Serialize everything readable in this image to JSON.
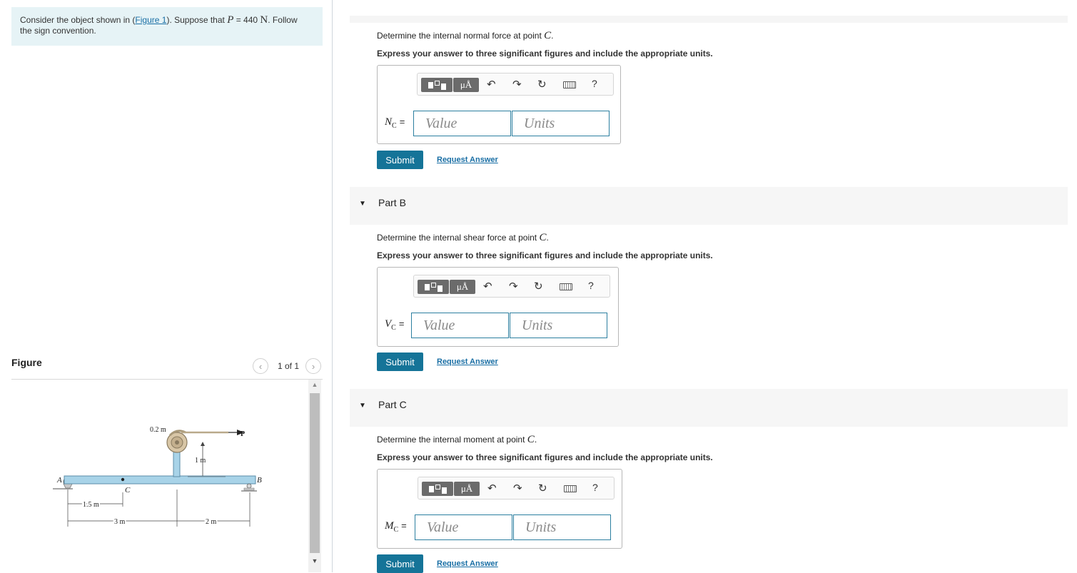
{
  "problem": {
    "text_before_link": "Consider the object shown in (",
    "figure_link": "Figure 1",
    "text_after_link": "). Suppose that",
    "var_P": "P",
    "equals": "= 440",
    "unit_N": "N",
    "text_end_1": ". Follow",
    "text_end_2": "the sign convention."
  },
  "figure_panel": {
    "title": "Figure",
    "counter": "1 of 1",
    "prev_icon": "chevron-left-icon",
    "next_icon": "chevron-right-icon",
    "labels": {
      "dim_02m": "0.2 m",
      "P": "P",
      "dim_1m": "1 m",
      "A": "A",
      "B": "B",
      "C": "C",
      "dim_15m": "1.5 m",
      "dim_3m": "3 m",
      "dim_2m": "2 m"
    }
  },
  "toolbar": {
    "templates_icon": "templates-icon",
    "units_label": "μÅ",
    "undo_icon": "undo-icon",
    "redo_icon": "redo-icon",
    "reset_icon": "reset-icon",
    "keyboard_icon": "keyboard-icon",
    "help_label": "?"
  },
  "parts": [
    {
      "id": "A",
      "question_before": "Determine the internal normal force at point",
      "question_point": "C",
      "instruction": "Express your answer to three significant figures and include the appropriate units.",
      "lhs_var": "N",
      "lhs_sub": "C",
      "lhs_eq": "=",
      "value_placeholder": "Value",
      "units_placeholder": "Units",
      "submit_label": "Submit",
      "request_label": "Request Answer"
    },
    {
      "id": "B",
      "header": "Part B",
      "question_before": "Determine the internal shear force at point",
      "question_point": "C",
      "instruction": "Express your answer to three significant figures and include the appropriate units.",
      "lhs_var": "V",
      "lhs_sub": "C",
      "lhs_eq": "=",
      "value_placeholder": "Value",
      "units_placeholder": "Units",
      "submit_label": "Submit",
      "request_label": "Request Answer"
    },
    {
      "id": "C",
      "header": "Part C",
      "question_before": "Determine the internal moment at point",
      "question_point": "C",
      "instruction": "Express your answer to three significant figures and include the appropriate units.",
      "lhs_var": "M",
      "lhs_sub": "C",
      "lhs_eq": "=",
      "value_placeholder": "Value",
      "units_placeholder": "Units",
      "submit_label": "Submit",
      "request_label": "Request Answer"
    }
  ]
}
